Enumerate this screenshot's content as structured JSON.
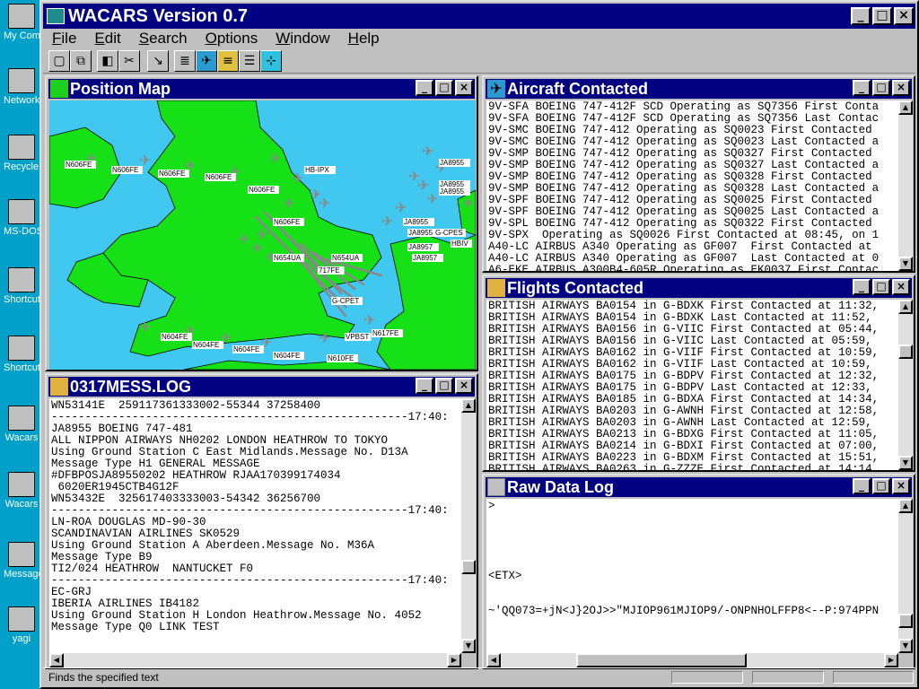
{
  "desktop": {
    "icons": [
      {
        "label": "My Computer",
        "name": "my-computer-icon"
      },
      {
        "label": "Network Neighborhood",
        "name": "network-neighborhood-icon"
      },
      {
        "label": "Recycle Bin",
        "name": "recycle-bin-icon"
      },
      {
        "label": "MS-DOS Prompt",
        "name": "ms-dos-prompt-icon"
      },
      {
        "label": "Shortcut to Merc",
        "name": "shortcut-merc-icon"
      },
      {
        "label": "Shortcut to Wacars",
        "name": "shortcut-wacars-icon"
      },
      {
        "label": "Wacars",
        "name": "wacars-icon"
      },
      {
        "label": "Wacars",
        "name": "wacars-folder-icon"
      },
      {
        "label": "Message",
        "name": "message-icon"
      },
      {
        "label": "yagi",
        "name": "yagi-icon"
      }
    ]
  },
  "app": {
    "title": "WACARS Version 0.7",
    "menu": [
      "File",
      "Edit",
      "Search",
      "Options",
      "Window",
      "Help"
    ],
    "toolbar_icons": [
      "new-icon",
      "open-icon",
      "cut-icon",
      "paste-icon",
      "filter-icon",
      "log-icon",
      "aircraft-icon",
      "list-icon",
      "raw-data-icon",
      "map-icon"
    ],
    "status": "Finds the specified text"
  },
  "windows": {
    "position_map": {
      "title": "Position Map",
      "labels": [
        "N606FE",
        "N606FE",
        "N606FE",
        "N606FE",
        "N606FE",
        "HB-IPX",
        "JA8955",
        "JA8955",
        "JA8955",
        "JA8955",
        "JA8955",
        "N606FE",
        "N654UA",
        "JA8957",
        "JA8957",
        "G-CPES",
        "HBIV",
        "717FE",
        "G-CPET",
        "N604FE",
        "N604FE",
        "N604FE",
        "N604FE",
        "N610FE",
        "N617FE",
        "VPBST",
        "N654UA"
      ]
    },
    "mess_log": {
      "title": "0317MESS.LOG",
      "lines": [
        "WN53141E  259117361333002-55344 37258400",
        "-----------------------------------------------------17:40:",
        "JA8955 BOEING 747-481",
        "ALL NIPPON AIRWAYS NH0202 LONDON HEATHROW TO TOKYO",
        "Using Ground Station C East Midlands.Message No. D13A",
        "Message Type H1 GENERAL MESSAGE",
        "#DFBPOSJA89550202 HEATHROW RJAA170399174034",
        " 6020ER1945CTB4G12F",
        "WN53432E  325617403333003-54342 36256700",
        "-----------------------------------------------------17:40:",
        "LN-ROA DOUGLAS MD-90-30",
        "SCANDINAVIAN AIRLINES SK0529",
        "Using Ground Station A Aberdeen.Message No. M36A",
        "Message Type B9",
        "TI2/024 HEATHROW  NANTUCKET F0",
        "-----------------------------------------------------17:40:",
        "EC-GRJ",
        "IBERIA AIRLINES IB4182",
        "Using Ground Station H London Heathrow.Message No. 4052",
        "Message Type Q0 LINK TEST"
      ]
    },
    "aircraft": {
      "title": "Aircraft Contacted",
      "lines": [
        "9V-SFA BOEING 747-412F SCD Operating as SQ7356 First Conta",
        "9V-SFA BOEING 747-412F SCD Operating as SQ7356 Last Contac",
        "9V-SMC BOEING 747-412 Operating as SQ0023 First Contacted",
        "9V-SMC BOEING 747-412 Operating as SQ0023 Last Contacted a",
        "9V-SMP BOEING 747-412 Operating as SQ0327 First Contacted",
        "9V-SMP BOEING 747-412 Operating as SQ0327 Last Contacted a",
        "9V-SMP BOEING 747-412 Operating as SQ0328 First Contacted",
        "9V-SMP BOEING 747-412 Operating as SQ0328 Last Contacted a",
        "9V-SPF BOEING 747-412 Operating as SQ0025 First Contacted",
        "9V-SPF BOEING 747-412 Operating as SQ0025 Last Contacted a",
        "9V-SPL BOEING 747-412 Operating as SQ0322 First Contacted",
        "9V-SPX  Operating as SQ0026 First Contacted at 08:45, on 1",
        "A40-LC AIRBUS A340 Operating as GF007  First Contacted at",
        "A40-LC AIRBUS A340 Operating as GF007  Last Contacted at 0",
        "A6-EKE AIRBUS A300B4-605R Operating as EK0037 First Contac"
      ]
    },
    "flights": {
      "title": "Flights Contacted",
      "lines": [
        "BRITISH AIRWAYS BA0154 in G-BDXK First Contacted at 11:32,",
        "BRITISH AIRWAYS BA0154 in G-BDXK Last Contacted at 11:52,",
        "BRITISH AIRWAYS BA0156 in G-VIIC First Contacted at 05:44,",
        "BRITISH AIRWAYS BA0156 in G-VIIC Last Contacted at 05:59,",
        "BRITISH AIRWAYS BA0162 in G-VIIF First Contacted at 10:59,",
        "BRITISH AIRWAYS BA0162 in G-VIIF Last Contacted at 10:59,",
        "BRITISH AIRWAYS BA0175 in G-BDPV First Contacted at 12:32,",
        "BRITISH AIRWAYS BA0175 in G-BDPV Last Contacted at 12:33,",
        "BRITISH AIRWAYS BA0185 in G-BDXA First Contacted at 14:34,",
        "BRITISH AIRWAYS BA0203 in G-AWNH First Contacted at 12:58,",
        "BRITISH AIRWAYS BA0203 in G-AWNH Last Contacted at 12:59,",
        "BRITISH AIRWAYS BA0213 in G-BDXG First Contacted at 11:05,",
        "BRITISH AIRWAYS BA0214 in G-BDXI First Contacted at 07:00,",
        "BRITISH AIRWAYS BA0223 in G-BDXM First Contacted at 15:51,",
        "BRITISH AIRWAYS BA0263 in G-ZZZE First Contacted at 14:14,"
      ]
    },
    "raw": {
      "title": "Raw Data Log",
      "lines": [
        ">",
        "",
        "",
        "",
        "",
        "",
        "<ETX>",
        "",
        "",
        "~'QQ073=+jN<J}2OJ>>\"MJIOP961MJIOP9/-ONPNHOLFFP8<--P:974PPN"
      ]
    }
  }
}
